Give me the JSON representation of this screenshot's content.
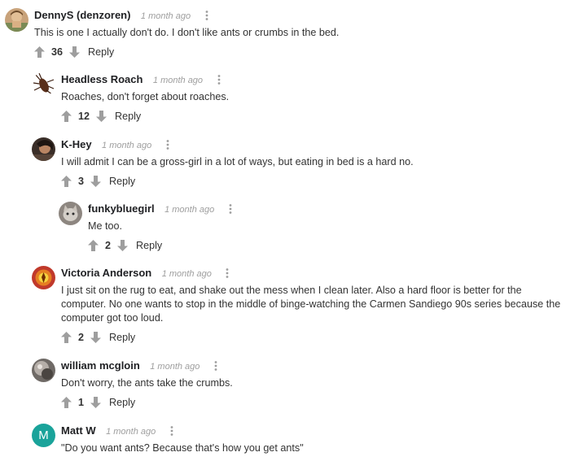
{
  "comments": [
    {
      "author": "DennyS (denzoren)",
      "time": "1 month ago",
      "text": "This is one I actually don't do. I don't like ants or crumbs in the bed.",
      "votes": "36",
      "reply_label": "Reply"
    },
    {
      "author": "Headless Roach",
      "time": "1 month ago",
      "text": "Roaches, don't forget about roaches.",
      "votes": "12",
      "reply_label": "Reply"
    },
    {
      "author": "K-Hey",
      "time": "1 month ago",
      "text": "I will admit I can be a gross-girl in a lot of ways, but eating in bed is a hard no.",
      "votes": "3",
      "reply_label": "Reply"
    },
    {
      "author": "funkybluegirl",
      "time": "1 month ago",
      "text": "Me too.",
      "votes": "2",
      "reply_label": "Reply"
    },
    {
      "author": "Victoria Anderson",
      "time": "1 month ago",
      "text": "I just sit on the rug to eat, and shake out the mess when I clean later. Also a hard floor is better for the computer. No one wants to stop in the middle of binge-watching the Carmen Sandiego 90s series because the computer got too loud.",
      "votes": "2",
      "reply_label": "Reply"
    },
    {
      "author": "william mcgloin",
      "time": "1 month ago",
      "text": "Don't worry, the ants take the crumbs.",
      "votes": "1",
      "reply_label": "Reply"
    },
    {
      "author": "Matt W",
      "time": "1 month ago",
      "text": "\"Do you want ants? Because that's how you get ants\"",
      "avatar_initial": "M",
      "avatar_color": "#1aa39a"
    }
  ],
  "colors": {
    "icon_gray": "#9e9e9e",
    "text": "#333333",
    "author": "#202124"
  },
  "icons": {
    "upvote": "arrow-up-icon",
    "downvote": "arrow-down-icon",
    "more": "vertical-dots-icon"
  }
}
